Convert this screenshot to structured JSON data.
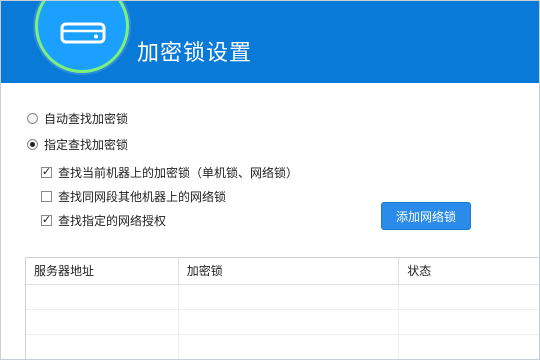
{
  "header": {
    "title": "加密锁设置",
    "icon": "device-icon"
  },
  "options": {
    "auto_search": {
      "label": "自动查找加密锁",
      "checked": false
    },
    "specified_search": {
      "label": "指定查找加密锁",
      "checked": true
    }
  },
  "checkboxes": [
    {
      "label": "查找当前机器上的加密锁（单机锁、网络锁）",
      "checked": true
    },
    {
      "label": "查找同网段其他机器上的网络锁",
      "checked": false
    },
    {
      "label": "查找指定的网络授权",
      "checked": true
    }
  ],
  "add_button": {
    "label": "添加网络锁"
  },
  "table": {
    "columns": [
      "服务器地址",
      "加密锁",
      "状态"
    ],
    "rows": [
      [
        "",
        "",
        ""
      ],
      [
        "",
        "",
        ""
      ],
      [
        "",
        "",
        ""
      ]
    ]
  },
  "colors": {
    "header_bg": "#0a7ad8",
    "accent": "#2a8bea",
    "ring": "#7cf07c"
  }
}
